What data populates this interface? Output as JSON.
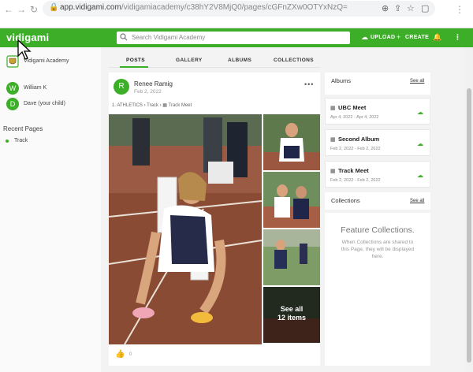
{
  "browser": {
    "url_domain": "app.vidigami.com",
    "url_path": "/vidigamiacademy/c38hY2V8MjQ0/pages/cGFnZXw0OTYxNzQ="
  },
  "topbar": {
    "logo": "vidigami",
    "search_placeholder": "Search Vidigami Academy",
    "upload_label": "UPLOAD",
    "create_label": "CREATE",
    "accent_color": "#3cae27"
  },
  "sidebar": {
    "org_name": "Vidigami Academy",
    "users": [
      {
        "initial": "W",
        "name": "William K"
      },
      {
        "initial": "D",
        "name": "Dave (your child)"
      }
    ],
    "recent_heading": "Recent Pages",
    "recent_pages": [
      "Track"
    ]
  },
  "tabs": [
    {
      "label": "POSTS",
      "active": true
    },
    {
      "label": "GALLERY",
      "active": false
    },
    {
      "label": "ALBUMS",
      "active": false
    },
    {
      "label": "COLLECTIONS",
      "active": false
    }
  ],
  "post": {
    "avatar_initial": "R",
    "author": "Renee Ramig",
    "date": "Feb 2, 2022",
    "breadcrumb": [
      "1. ATHLETICS",
      "Track",
      "Track Meet"
    ],
    "see_all_line1": "See all",
    "see_all_line2": "12 items",
    "like_count": "0"
  },
  "albums_panel": {
    "heading": "Albums",
    "see_all": "See all",
    "items": [
      {
        "title": "UBC Meet",
        "dates": "Apr 4, 2022 - Apr 4, 2022"
      },
      {
        "title": "Second Album",
        "dates": "Feb 2, 2022 - Feb 2, 2022"
      },
      {
        "title": "Track Meet",
        "dates": "Feb 2, 2022 - Feb 2, 2022"
      }
    ]
  },
  "collections_panel": {
    "heading": "Collections",
    "see_all": "See all",
    "feature_title": "Feature Collections.",
    "feature_text": "When Collections are shared to this Page, they will be displayed here."
  }
}
